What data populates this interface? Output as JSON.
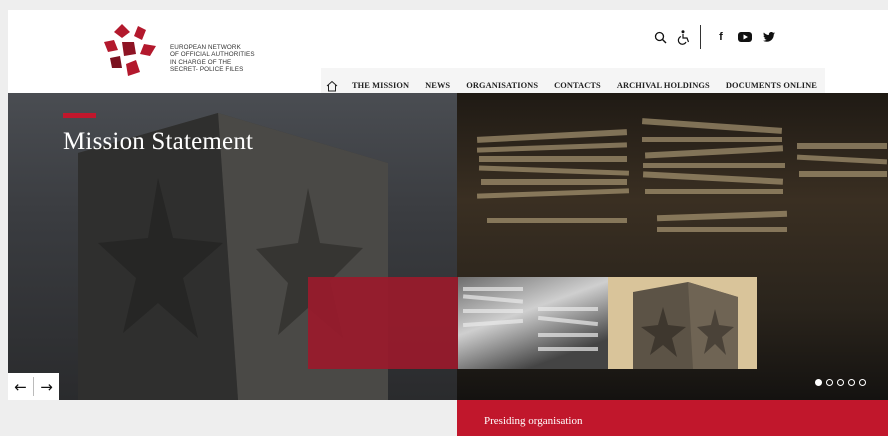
{
  "brand": {
    "logo_lines": [
      "EUROPEAN NETWORK",
      "OF OFFICIAL AUTHORITIES",
      "IN CHARGE OF THE",
      "SECRET- POLICE FILES"
    ],
    "logo_color": "#b3192d"
  },
  "utility": {
    "icons": [
      "search-icon",
      "accessibility-icon",
      "facebook-icon",
      "youtube-icon",
      "twitter-icon"
    ],
    "facebook_glyph": "f"
  },
  "nav": {
    "home_icon": "home-icon",
    "items": [
      {
        "label": "THE MISSION"
      },
      {
        "label": "NEWS"
      },
      {
        "label": "ORGANISATIONS"
      },
      {
        "label": "CONTACTS"
      },
      {
        "label": "ARCHIVAL HOLDINGS"
      },
      {
        "label": "DOCUMENTS ONLINE"
      }
    ]
  },
  "hero": {
    "title": "Mission Statement",
    "accent_color": "#c1172c",
    "prev_arrow": "←",
    "next_arrow": "→",
    "slide_count": 5,
    "active_slide": 1
  },
  "presiding": {
    "label": "Presiding organisation"
  }
}
